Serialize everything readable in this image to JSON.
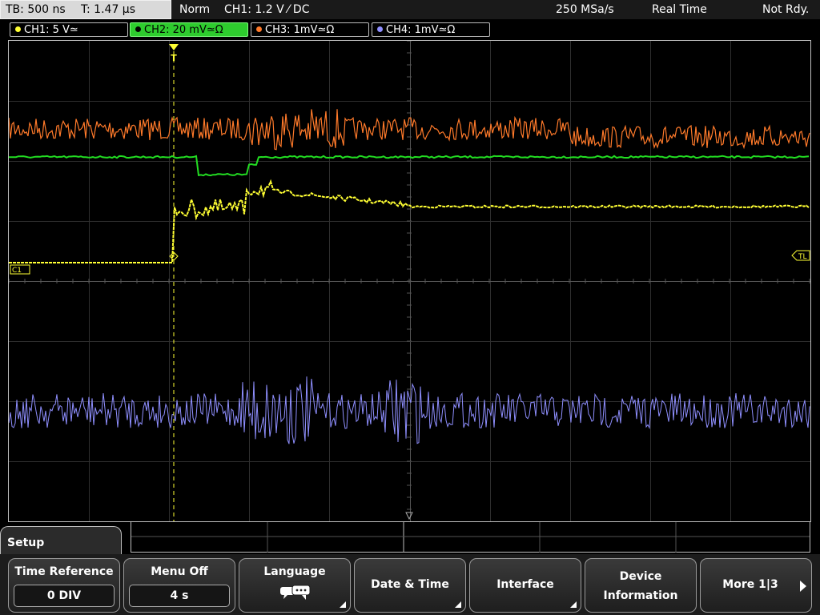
{
  "statusbar": {
    "timebase": "TB: 500 ns",
    "trigger_time": "T: 1.47 µs",
    "acq_mode": "Norm",
    "trigger_setting": "CH1: 1.2 V ⁄ DC",
    "sample_rate": "250 MSa/s",
    "acq_type": "Real Time",
    "state": "Not Rdy."
  },
  "channels": [
    {
      "label": "CH1: 5 V≃",
      "color": "#ffff33"
    },
    {
      "label": "CH2: 20 mV≃Ω",
      "color": "#22dd22"
    },
    {
      "label": "CH3: 1mV≃Ω",
      "color": "#ff7a2a"
    },
    {
      "label": "CH4: 1mV≃Ω",
      "color": "#8f8fff"
    }
  ],
  "markers": {
    "c1": "C1",
    "tl": "TL",
    "trigger": "T"
  },
  "menu": {
    "title": "Setup",
    "softkeys": [
      {
        "label": "Time Reference",
        "value": "0 DIV"
      },
      {
        "label": "Menu Off",
        "value": "4 s"
      },
      {
        "label": "Language",
        "icon": "speech-bubbles-icon"
      },
      {
        "label": "Date & Time"
      },
      {
        "label": "Interface"
      },
      {
        "label_line1": "Device",
        "label_line2": "Information"
      },
      {
        "label": "More 1|3"
      }
    ]
  }
}
